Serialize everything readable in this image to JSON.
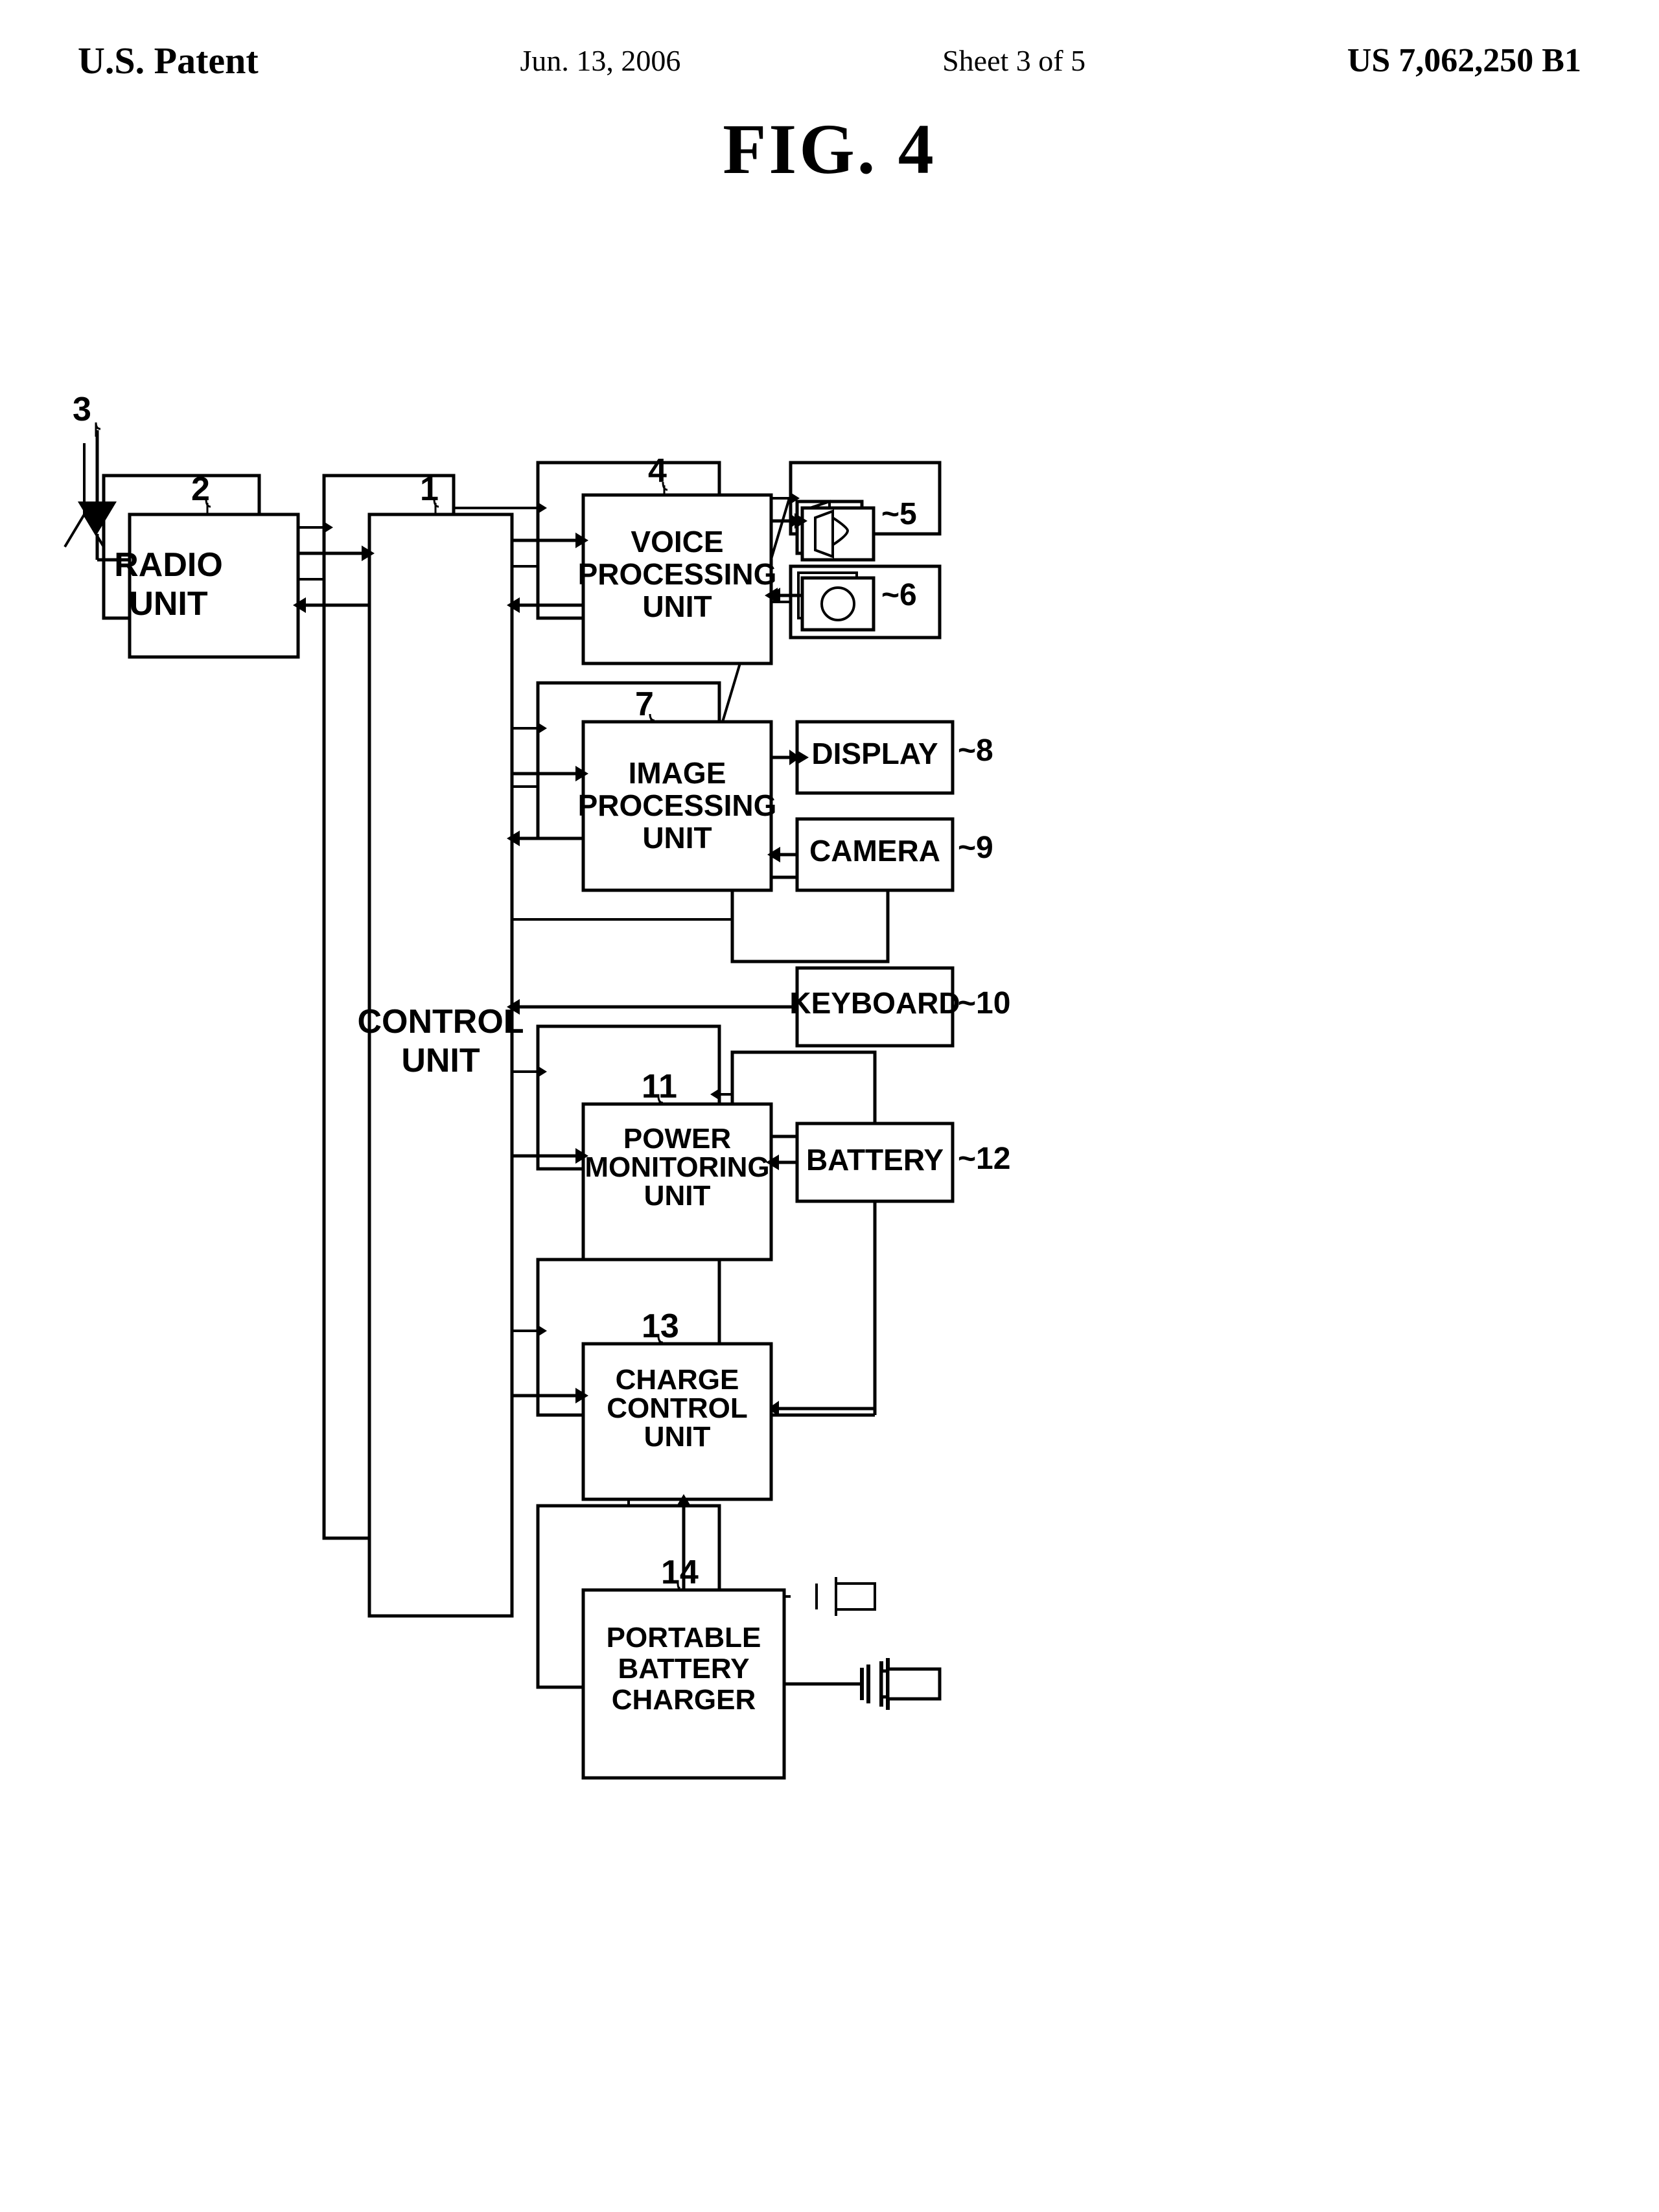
{
  "header": {
    "patent_office": "U.S. Patent",
    "date": "Jun. 13, 2006",
    "sheet": "Sheet 3 of 5",
    "patent_number": "US 7,062,250 B1"
  },
  "figure": {
    "label": "FIG. 4"
  },
  "nodes": {
    "radio_unit": "RADIO\nUNIT",
    "control_unit": "CONTROL\nUNIT",
    "voice_processing": "VOICE\nPROCESSING\nUNIT",
    "image_processing": "IMAGE\nPROCESSING\nUNIT",
    "display": "DISPLAY",
    "camera": "CAMERA",
    "keyboard": "KEYBOARD",
    "power_monitoring": "POWER\nMONITORING\nUNIT",
    "battery": "BATTERY",
    "charge_control": "CHARGE\nCONTROL\nUNIT",
    "portable_battery_charger": "PORTABLE\nBATTERY\nCHARGER"
  },
  "labels": {
    "n1": "1",
    "n2": "2",
    "n3": "3",
    "n4": "4",
    "n5": "5",
    "n6": "6",
    "n7": "7",
    "n8": "8",
    "n9": "9",
    "n10": "10",
    "n11": "11",
    "n12": "12",
    "n13": "13",
    "n14": "14"
  }
}
